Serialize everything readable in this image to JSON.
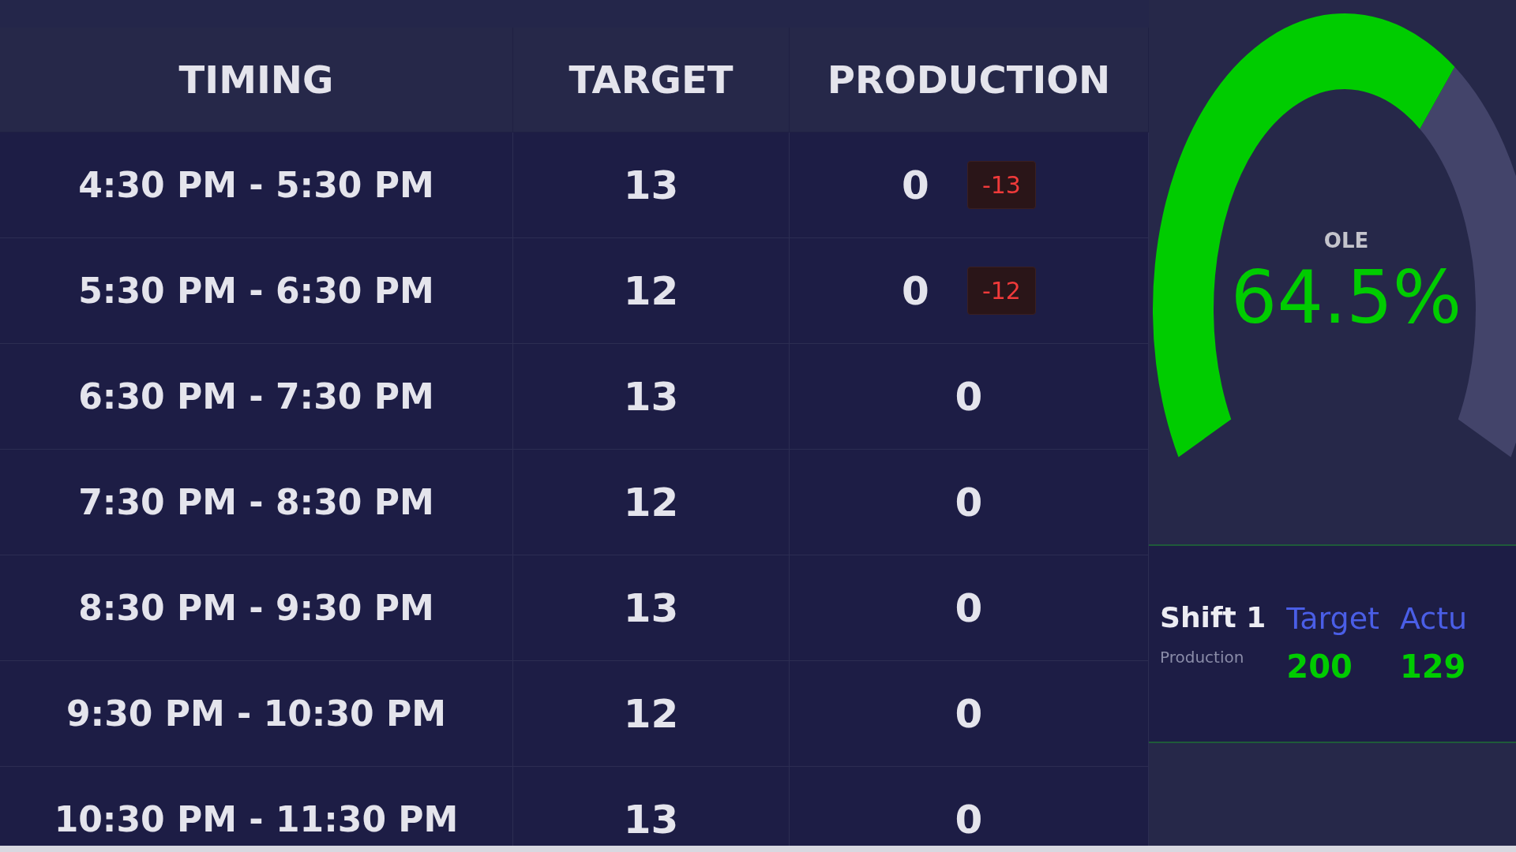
{
  "table": {
    "columns": [
      "TIMING",
      "TARGET",
      "PRODUCTION"
    ],
    "rows": [
      {
        "timing": "4:30 PM - 5:30 PM",
        "target": "13",
        "production": "0",
        "variance": "-13"
      },
      {
        "timing": "5:30 PM - 6:30 PM",
        "target": "12",
        "production": "0",
        "variance": "-12"
      },
      {
        "timing": "6:30 PM - 7:30 PM",
        "target": "13",
        "production": "0"
      },
      {
        "timing": "7:30 PM - 8:30 PM",
        "target": "12",
        "production": "0"
      },
      {
        "timing": "8:30 PM - 9:30 PM",
        "target": "13",
        "production": "0"
      },
      {
        "timing": "9:30 PM - 10:30 PM",
        "target": "12",
        "production": "0"
      },
      {
        "timing": "10:30 PM - 11:30 PM",
        "target": "13",
        "production": "0"
      }
    ]
  },
  "gauge": {
    "label": "OLE",
    "value": "64.5%"
  },
  "shift": {
    "title": "Shift 1",
    "subtitle": "Production",
    "columns": [
      {
        "label": "Target",
        "value": "200"
      },
      {
        "label": "Actu",
        "value": "129"
      }
    ]
  }
}
